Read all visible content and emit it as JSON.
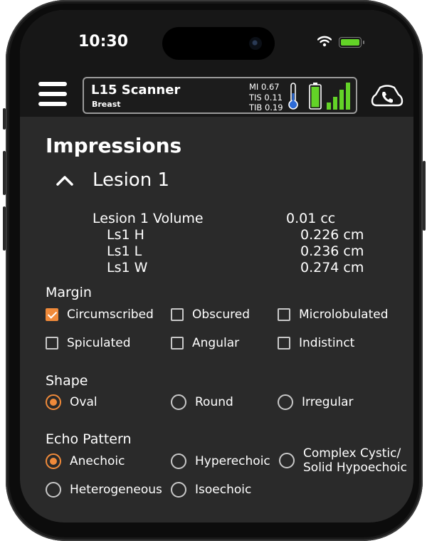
{
  "status_bar": {
    "time": "10:30"
  },
  "app_bar": {
    "probe": "L15 Scanner",
    "preset": "Breast",
    "mi": "MI 0.67",
    "tis": "TIS 0.11",
    "tib": "TIB 0.19",
    "accent_green": "#63d327",
    "thermo_color": "#2e6bd6"
  },
  "impressions": {
    "title": "Impressions",
    "lesion": {
      "title": "Lesion 1",
      "volume_label": "Lesion 1 Volume",
      "volume_value": "0.01 cc",
      "measurements": [
        {
          "label": "Ls1 H",
          "value": "0.226 cm"
        },
        {
          "label": "Ls1 L",
          "value": "0.236 cm"
        },
        {
          "label": "Ls1 W",
          "value": "0.274 cm"
        }
      ]
    },
    "margin": {
      "label": "Margin",
      "options": [
        {
          "label": "Circumscribed",
          "checked": true
        },
        {
          "label": "Obscured",
          "checked": false
        },
        {
          "label": "Microlobulated",
          "checked": false
        },
        {
          "label": "Spiculated",
          "checked": false
        },
        {
          "label": "Angular",
          "checked": false
        },
        {
          "label": "Indistinct",
          "checked": false
        }
      ]
    },
    "shape": {
      "label": "Shape",
      "options": [
        {
          "label": "Oval",
          "checked": true
        },
        {
          "label": "Round",
          "checked": false
        },
        {
          "label": "Irregular",
          "checked": false
        }
      ]
    },
    "echo": {
      "label": "Echo Pattern",
      "options": [
        {
          "label": "Anechoic",
          "checked": true
        },
        {
          "label": "Hyperechoic",
          "checked": false
        },
        {
          "label_line1": "Complex Cystic/",
          "label_line2": "Solid Hypoechoic",
          "checked": false
        },
        {
          "label": "Heterogeneous",
          "checked": false
        },
        {
          "label": "Isoechoic",
          "checked": false
        }
      ]
    },
    "accent": "#f08a3a"
  }
}
